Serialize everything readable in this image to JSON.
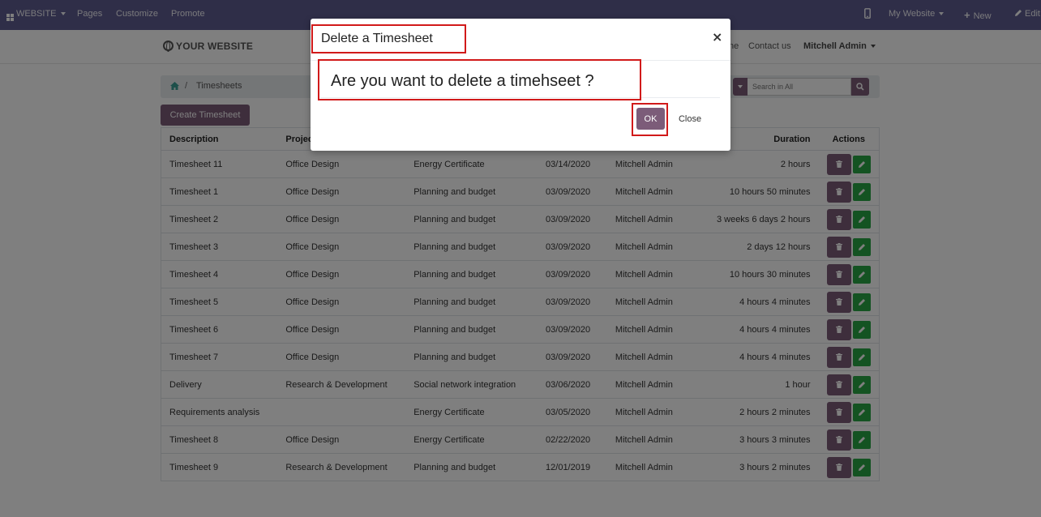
{
  "topbar": {
    "app_menu": "WEBSITE",
    "pages": "Pages",
    "customize": "Customize",
    "promote": "Promote",
    "my_website": "My Website",
    "new": "New",
    "edit": "Edit"
  },
  "header": {
    "logo": "YOUR WEBSITE",
    "nav_partial": "ne",
    "contact": "Contact us",
    "user": "Mitchell Admin"
  },
  "breadcrumb": {
    "separator": "/",
    "current": "Timesheets"
  },
  "search": {
    "placeholder": "Search in All"
  },
  "create_button": "Create Timesheet",
  "table": {
    "headers": {
      "description": "Description",
      "project": "Project",
      "duration": "Duration",
      "actions": "Actions"
    },
    "rows": [
      {
        "description": "Timesheet 11",
        "project": "Office Design",
        "task": "Energy Certificate",
        "date": "03/14/2020",
        "employee": "Mitchell Admin",
        "duration": "2 hours"
      },
      {
        "description": "Timesheet 1",
        "project": "Office Design",
        "task": "Planning and budget",
        "date": "03/09/2020",
        "employee": "Mitchell Admin",
        "duration": "10 hours 50 minutes"
      },
      {
        "description": "Timesheet 2",
        "project": "Office Design",
        "task": "Planning and budget",
        "date": "03/09/2020",
        "employee": "Mitchell Admin",
        "duration": "3 weeks 6 days 2 hours"
      },
      {
        "description": "Timesheet 3",
        "project": "Office Design",
        "task": "Planning and budget",
        "date": "03/09/2020",
        "employee": "Mitchell Admin",
        "duration": "2 days 12 hours"
      },
      {
        "description": "Timesheet 4",
        "project": "Office Design",
        "task": "Planning and budget",
        "date": "03/09/2020",
        "employee": "Mitchell Admin",
        "duration": "10 hours 30 minutes"
      },
      {
        "description": "Timesheet 5",
        "project": "Office Design",
        "task": "Planning and budget",
        "date": "03/09/2020",
        "employee": "Mitchell Admin",
        "duration": "4 hours 4 minutes"
      },
      {
        "description": "Timesheet 6",
        "project": "Office Design",
        "task": "Planning and budget",
        "date": "03/09/2020",
        "employee": "Mitchell Admin",
        "duration": "4 hours 4 minutes"
      },
      {
        "description": "Timesheet 7",
        "project": "Office Design",
        "task": "Planning and budget",
        "date": "03/09/2020",
        "employee": "Mitchell Admin",
        "duration": "4 hours 4 minutes"
      },
      {
        "description": "Delivery",
        "project": "Research & Development",
        "task": "Social network integration",
        "date": "03/06/2020",
        "employee": "Mitchell Admin",
        "duration": "1 hour"
      },
      {
        "description": "Requirements analysis",
        "project": "",
        "task": "Energy Certificate",
        "date": "03/05/2020",
        "employee": "Mitchell Admin",
        "duration": "2 hours 2 minutes"
      },
      {
        "description": "Timesheet 8",
        "project": "Office Design",
        "task": "Energy Certificate",
        "date": "02/22/2020",
        "employee": "Mitchell Admin",
        "duration": "3 hours 3 minutes"
      },
      {
        "description": "Timesheet 9",
        "project": "Research & Development",
        "task": "Planning and budget",
        "date": "12/01/2019",
        "employee": "Mitchell Admin",
        "duration": "3 hours 2 minutes"
      }
    ]
  },
  "modal": {
    "title": "Delete a Timesheet",
    "close_glyph": "×",
    "message": "Are you want to delete a timehseet ?",
    "ok": "OK",
    "close": "Close"
  },
  "icons": {
    "app_grid": "grid-icon",
    "mobile": "mobile-icon",
    "new": "plus-icon",
    "edit": "pencil-icon",
    "home": "home-icon",
    "search": "search-icon",
    "delete": "trash-icon",
    "row_edit": "pencil-icon"
  },
  "colors": {
    "topbar": "#5f5c91",
    "primary": "#7c5c79",
    "edit_button": "#28a745",
    "highlight": "#d11a1a"
  }
}
